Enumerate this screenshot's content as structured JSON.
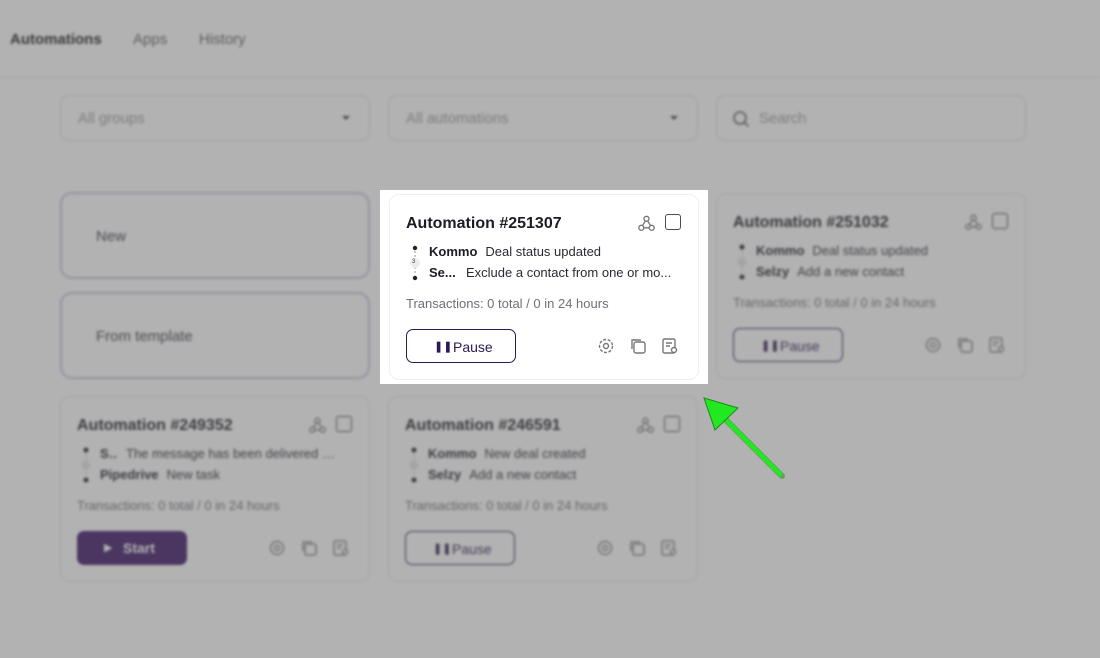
{
  "nav": {
    "items": [
      {
        "label": "Automations",
        "active": true
      },
      {
        "label": "Apps",
        "active": false
      },
      {
        "label": "History",
        "active": false
      }
    ]
  },
  "filters": {
    "groups_placeholder": "All groups",
    "automations_placeholder": "All automations",
    "search_placeholder": "Search"
  },
  "create": {
    "new_label": "New",
    "template_label": "From template"
  },
  "cards": [
    {
      "title": "Automation #251307",
      "trigger_app": "Kommo",
      "trigger_desc": "Deal status updated",
      "step_count": "3",
      "action_app": "Se...",
      "action_desc": "Exclude a contact from one or mo...",
      "transactions": "Transactions: 0 total / 0 in 24 hours",
      "button_glyph": "❚❚",
      "button_label": "Pause",
      "state": "paused-button"
    },
    {
      "title": "Automation #251032",
      "trigger_app": "Kommo",
      "trigger_desc": "Deal status updated",
      "action_app": "Selzy",
      "action_desc": "Add a new contact",
      "transactions": "Transactions: 0 total / 0 in 24 hours",
      "button_glyph": "❚❚",
      "button_label": "Pause"
    },
    {
      "title": "Automation #249352",
      "trigger_app": "S...",
      "trigger_desc": "The message has been delivered an...",
      "action_app": "Pipedrive",
      "action_desc": "New task",
      "transactions": "Transactions: 0 total / 0 in 24 hours",
      "button_glyph": "▶",
      "button_label": "Start"
    },
    {
      "title": "Automation #246591",
      "trigger_app": "Kommo",
      "trigger_desc": "New deal created",
      "action_app": "Selzy",
      "action_desc": "Add a new contact",
      "transactions": "Transactions: 0 total / 0 in 24 hours",
      "button_glyph": "❚❚",
      "button_label": "Pause"
    }
  ],
  "colors": {
    "brand": "#3b1266",
    "arrow": "#22e822",
    "overlay": "#5f5f5f"
  }
}
